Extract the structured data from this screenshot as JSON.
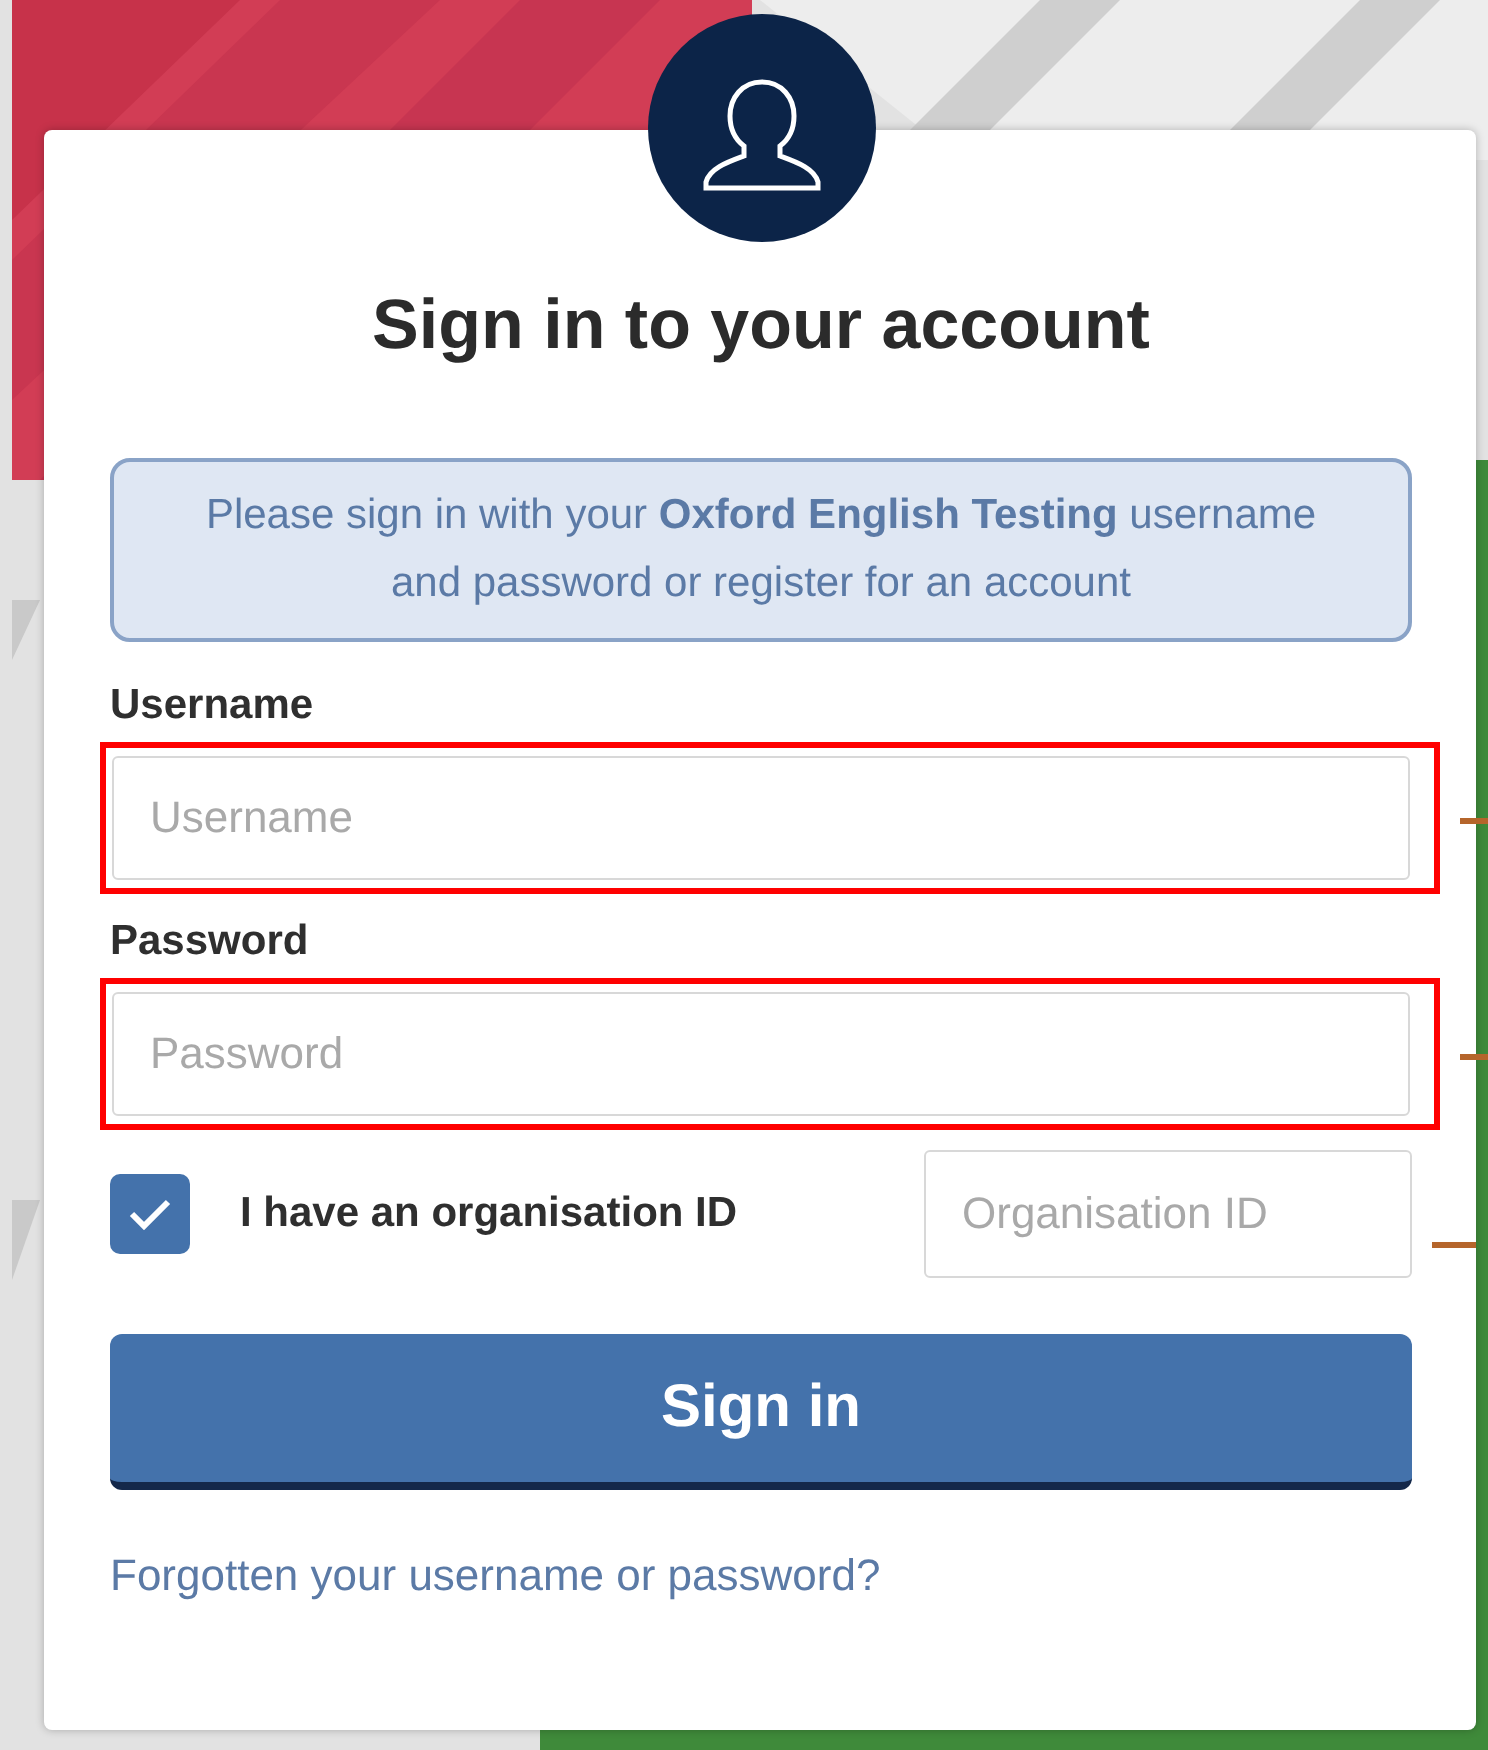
{
  "title": "Sign in to your account",
  "notice": "Please sign in with your **Oxford English Testing** username and password or register for an account",
  "fields": [
    {
      "label": "Username",
      "placeholder": "Username",
      "highlighted": true,
      "pointer": true
    },
    {
      "label": "Password",
      "placeholder": "Password",
      "highlighted": true,
      "pointer": true
    }
  ],
  "organisation": {
    "label": "I have an organisation ID",
    "checked": true,
    "placeholder": "Organisation ID",
    "pointer": true
  },
  "submit": "Sign in",
  "forgot_link": "Forgotten your username or password?"
}
